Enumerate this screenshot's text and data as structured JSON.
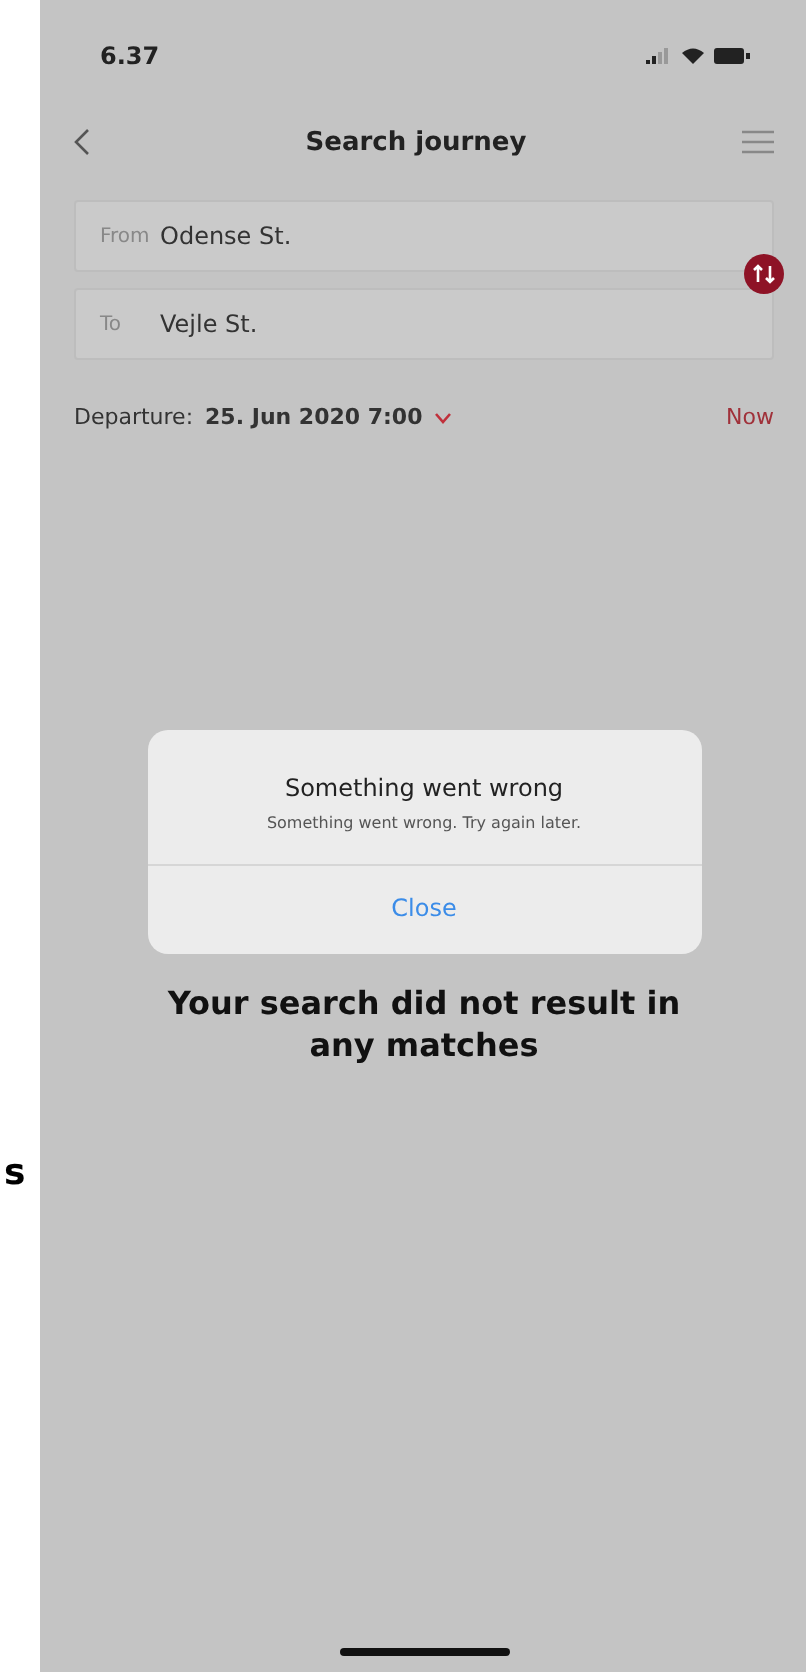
{
  "edge_text": "s",
  "status_bar": {
    "time": "6.37"
  },
  "header": {
    "title": "Search journey"
  },
  "fields": [
    {
      "label": "From",
      "value": "Odense St."
    },
    {
      "label": "To",
      "value": "Vejle St."
    }
  ],
  "departure": {
    "label": "Departure:",
    "value": "25. Jun 2020 7:00",
    "now": "Now"
  },
  "dialog": {
    "title": "Something went wrong",
    "message": "Something went wrong. Try again later.",
    "button": "Close"
  },
  "empty_message": "Your search did not result in any matches"
}
